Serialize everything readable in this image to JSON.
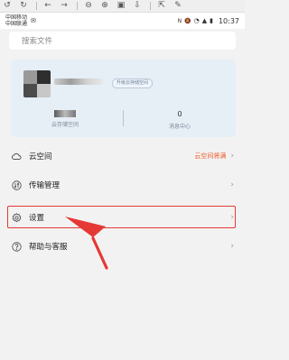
{
  "status_bar": {
    "carrier_1": "中国移动",
    "carrier_2": "中国联通",
    "time": "10:37"
  },
  "search": {
    "placeholder": "搜索文件"
  },
  "profile": {
    "upgrade_label": "升级云存储空间",
    "storage_label": "云存储空间",
    "messages_value": "0",
    "messages_label": "消息中心"
  },
  "menu": {
    "items": [
      {
        "label": "云空间",
        "status": "云空间将满",
        "icon": "cloud-icon"
      },
      {
        "label": "传输管理",
        "status": "",
        "icon": "transfer-icon"
      },
      {
        "label": "设置",
        "status": "",
        "icon": "gear-icon"
      },
      {
        "label": "帮助与客服",
        "status": "",
        "icon": "help-icon"
      }
    ]
  },
  "colors": {
    "accent_red": "#e53935",
    "warning_text": "#f05a28"
  }
}
